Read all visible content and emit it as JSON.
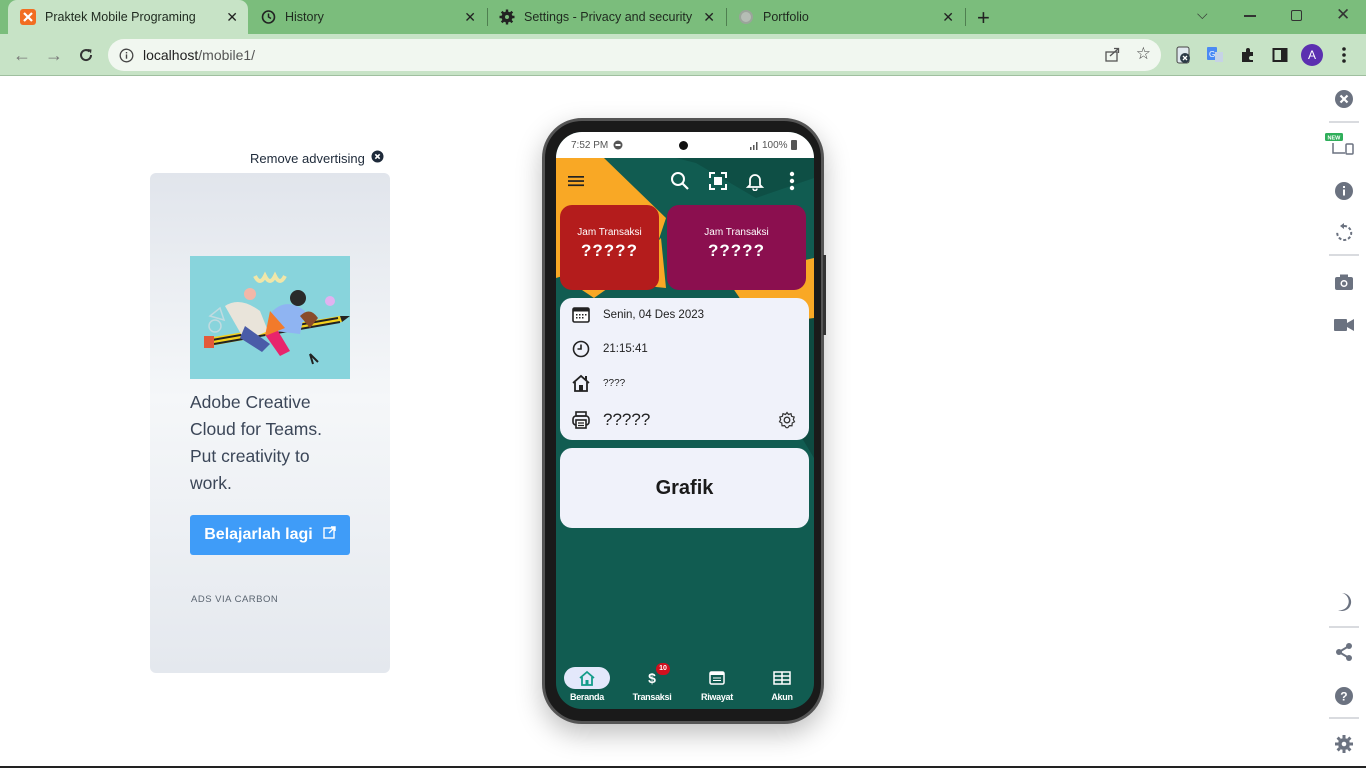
{
  "browser": {
    "tabs": [
      {
        "title": "Praktek Mobile Programing",
        "icon": "xampp-icon",
        "active": true
      },
      {
        "title": "History",
        "icon": "history-icon",
        "active": false
      },
      {
        "title": "Settings - Privacy and security",
        "icon": "gear-icon",
        "active": false
      },
      {
        "title": "Portfolio",
        "icon": "globe-icon",
        "active": false
      }
    ],
    "url_host": "localhost",
    "url_path": "/mobile1/",
    "profile_initial": "A",
    "colors": {
      "tabbar": "#7bbd7c",
      "toolbar": "#c7e3c6",
      "profile": "#5b2fb0"
    }
  },
  "ad": {
    "remove_label": "Remove advertising",
    "text": "Adobe Creative Cloud for Teams. Put creativity to work.",
    "button_label": "Belajarlah lagi",
    "footer": "ADS VIA CARBON",
    "button_color": "#3f9cf8"
  },
  "phone": {
    "status": {
      "time": "7:52 PM",
      "battery": "100%"
    },
    "cards": [
      {
        "label": "Jam Transaksi",
        "value": "?????",
        "color": "#b41c1c"
      },
      {
        "label": "Jam Transaksi",
        "value": "?????",
        "color": "#8b0f4f"
      }
    ],
    "info": {
      "date": "Senin, 04 Des 2023",
      "time": "21:15:41",
      "store": "????",
      "printer": "?????"
    },
    "grafik_label": "Grafik",
    "bottom_nav": [
      {
        "label": "Beranda",
        "icon": "home-icon",
        "active": true
      },
      {
        "label": "Transaksi",
        "icon": "dollar-icon",
        "badge": "10"
      },
      {
        "label": "Riwayat",
        "icon": "receipt-icon"
      },
      {
        "label": "Akun",
        "icon": "table-icon"
      }
    ],
    "colors": {
      "background": "#115c51",
      "accent": "#f9a825",
      "card_bg": "#f0f2fa"
    }
  },
  "devtools_rail": {
    "new_badge": "NEW"
  }
}
